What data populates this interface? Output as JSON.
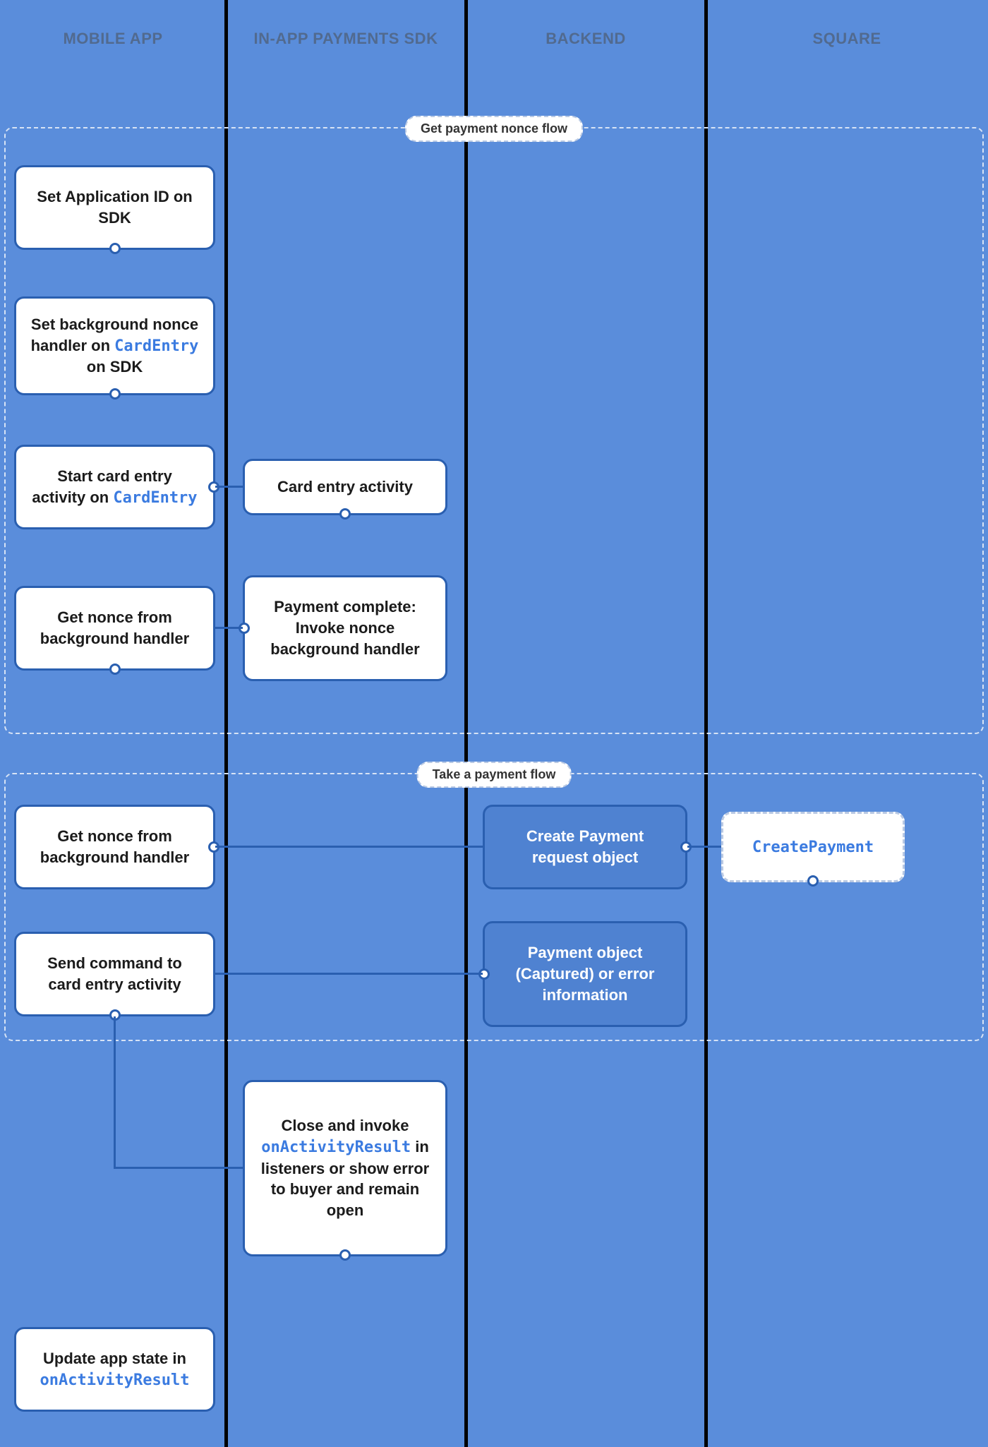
{
  "lanes": {
    "mobile": "MOBILE APP",
    "sdk": "IN-APP PAYMENTS SDK",
    "backend": "BACKEND",
    "square": "SQUARE"
  },
  "flows": {
    "nonce": "Get payment nonce flow",
    "payment": "Take a payment flow"
  },
  "cards": {
    "setAppId": "Set Application ID on SDK",
    "setBgHandler_pre": "Set background nonce handler on ",
    "setBgHandler_code": "CardEntry",
    "setBgHandler_post": " on SDK",
    "startCard_pre": "Start card entry activity on ",
    "startCard_code": "CardEntry",
    "cardEntryActivity": "Card entry activity",
    "getNonce1": "Get nonce from background handler",
    "paymentComplete": "Payment complete: Invoke nonce background handler",
    "getNonce2": "Get nonce from background handler",
    "createPaymentReq": "Create Payment request object",
    "createPaymentApi": "CreatePayment",
    "sendCommand": "Send command to card entry activity",
    "paymentObject": "Payment object (Captured) or error information",
    "closeInvoke_pre": "Close and invoke ",
    "closeInvoke_code": "onActivityResult",
    "closeInvoke_post": " in listeners or show error to buyer and remain open",
    "updateState_pre": "Update app state in ",
    "updateState_code": "onActivityResult"
  }
}
